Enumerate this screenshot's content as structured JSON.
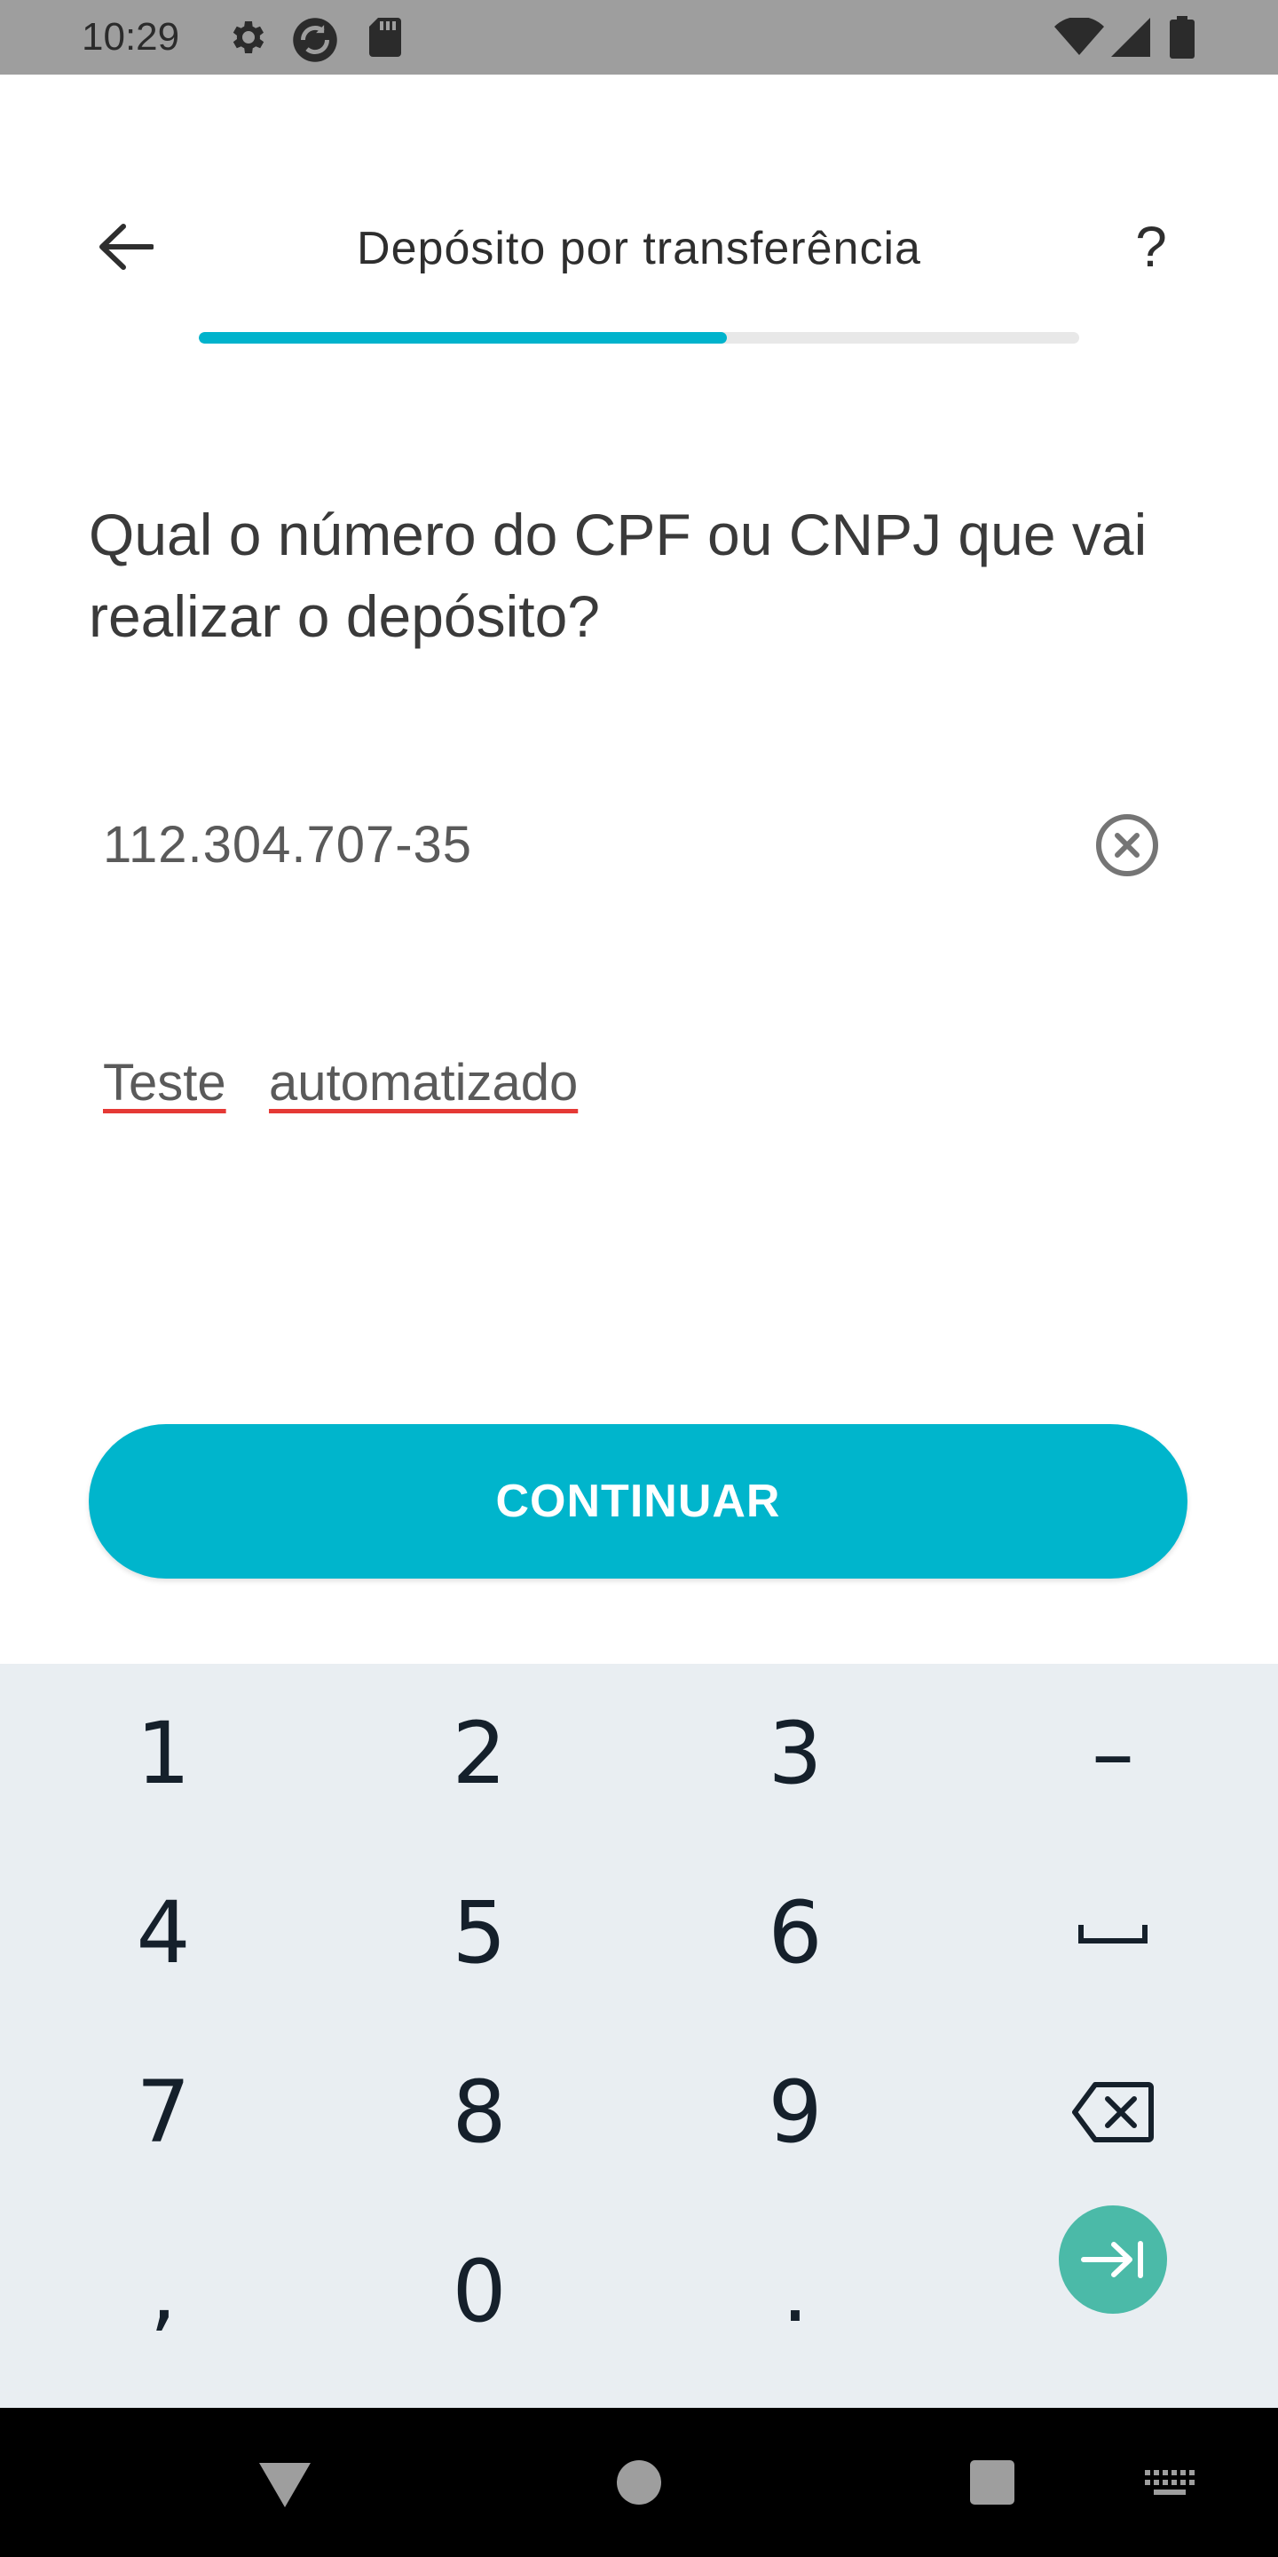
{
  "status_bar": {
    "time": "10:29",
    "left_icons": [
      "gear-icon",
      "sync-app-icon",
      "sd-card-icon"
    ],
    "right_icons": [
      "wifi-icon",
      "signal-icon",
      "battery-icon"
    ]
  },
  "header": {
    "title": "Depósito por transferência",
    "help_label": "?",
    "progress_fraction": 0.6
  },
  "form": {
    "question": "Qual o número do CPF ou CNPJ que vai realizar o depósito?",
    "cpf_value": "112.304.707-35",
    "description_words": [
      "Teste",
      "automatizado"
    ]
  },
  "continue_label": "CONTINUAR",
  "keyboard": {
    "rows": [
      [
        "1",
        "2",
        "3",
        "–"
      ],
      [
        "4",
        "5",
        "6",
        "space"
      ],
      [
        "7",
        "8",
        "9",
        "backspace"
      ],
      [
        ",",
        "0",
        ".",
        "tab"
      ]
    ]
  },
  "colors": {
    "accent": "#00b5cc",
    "keyboard_bg": "#e9eef2",
    "tab_key": "#4bbaa8",
    "spellcheck": "#e53935"
  }
}
